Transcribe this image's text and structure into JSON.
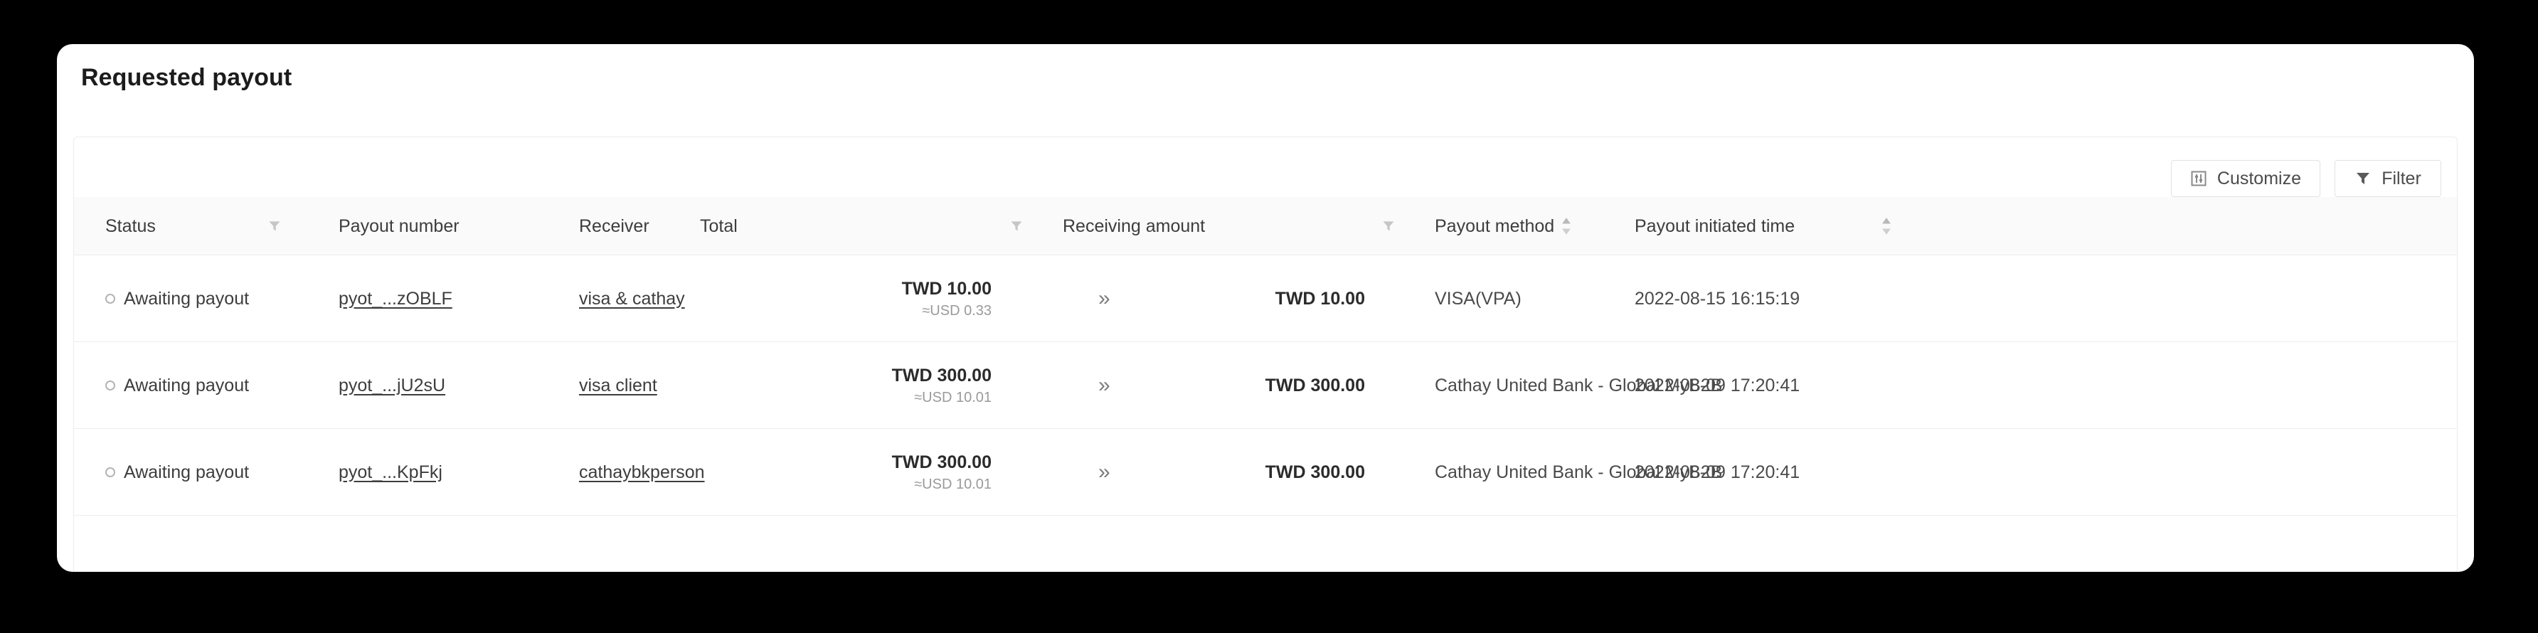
{
  "card": {
    "title": "Requested payout"
  },
  "toolbar": {
    "customize_label": "Customize",
    "customize_icon": "sliders-icon",
    "filter_label": "Filter",
    "filter_icon": "funnel-icon"
  },
  "table": {
    "columns": [
      {
        "key": "status",
        "label": "Status",
        "icon": "filter-funnel-icon",
        "align": "left"
      },
      {
        "key": "payout_number",
        "label": "Payout number",
        "icon": "none",
        "align": "left"
      },
      {
        "key": "receiver",
        "label": "Receiver",
        "icon": "none",
        "align": "left"
      },
      {
        "key": "total",
        "label": "Total",
        "icon": "filter-funnel-icon",
        "align": "left"
      },
      {
        "key": "receiving",
        "label": "Receiving amount",
        "icon": "filter-funnel-icon",
        "align": "left"
      },
      {
        "key": "method",
        "label": "Payout method",
        "icon": "sort-arrows-icon",
        "align": "left"
      },
      {
        "key": "initiated",
        "label": "Payout initiated time",
        "icon": "sort-arrows-icon",
        "align": "left"
      }
    ],
    "separator_glyph": "»",
    "rows": [
      {
        "status": "Awaiting payout",
        "status_style": "hollow-circle",
        "payout_number": "pyot_...zOBLF",
        "receiver": "visa & cathay",
        "total_main": "TWD 10.00",
        "total_sub": "≈USD 0.33",
        "receiving_amount": "TWD 10.00",
        "payout_method": "VISA(VPA)",
        "payout_initiated_time": "2022-08-15 16:15:19"
      },
      {
        "status": "Awaiting payout",
        "status_style": "hollow-circle",
        "payout_number": "pyot_...jU2sU",
        "receiver": "visa client",
        "total_main": "TWD 300.00",
        "total_sub": "≈USD 10.01",
        "receiving_amount": "TWD 300.00",
        "payout_method": "Cathay United Bank - Global MyB2B",
        "payout_initiated_time": "2022-08-09 17:20:41"
      },
      {
        "status": "Awaiting payout",
        "status_style": "hollow-circle",
        "payout_number": "pyot_...KpFkj",
        "receiver": "cathaybkperson",
        "total_main": "TWD 300.00",
        "total_sub": "≈USD 10.01",
        "receiving_amount": "TWD 300.00",
        "payout_method": "Cathay United Bank - Global MyB2B",
        "payout_initiated_time": "2022-08-09 17:20:41"
      }
    ]
  },
  "colors": {
    "page_background": "#000000",
    "card_background": "#ffffff",
    "header_band": "#fafafa",
    "border": "#ececec",
    "text_primary": "#3d3d3d",
    "text_muted": "#9a9a9a"
  }
}
